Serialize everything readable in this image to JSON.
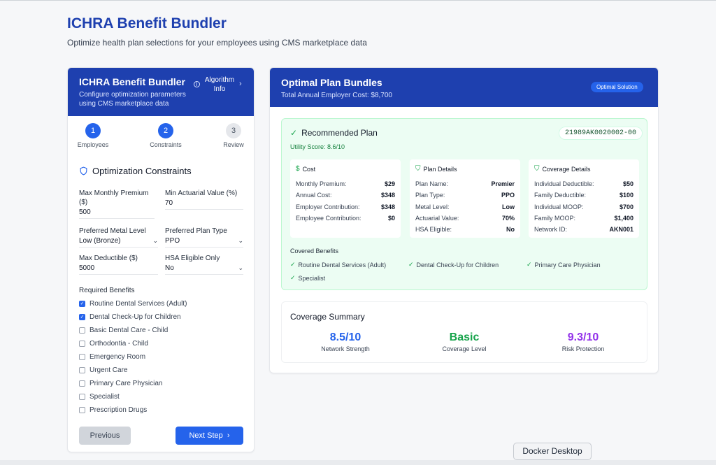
{
  "page": {
    "title": "ICHRA Benefit Bundler",
    "subtitle": "Optimize health plan selections for your employees using CMS marketplace data"
  },
  "left": {
    "header_title": "ICHRA Benefit Bundler",
    "header_desc": "Configure optimization parameters using CMS marketplace data",
    "algo_label": "Algorithm Info",
    "steps": [
      {
        "num": "1",
        "label": "Employees"
      },
      {
        "num": "2",
        "label": "Constraints"
      },
      {
        "num": "3",
        "label": "Review"
      }
    ],
    "section_title": "Optimization Constraints",
    "fields": {
      "max_premium_label": "Max Monthly Premium ($)",
      "max_premium_value": "500",
      "min_av_label": "Min Actuarial Value (%)",
      "min_av_value": "70",
      "metal_label": "Preferred Metal Level",
      "metal_value": "Low (Bronze)",
      "plan_type_label": "Preferred Plan Type",
      "plan_type_value": "PPO",
      "deductible_label": "Max Deductible ($)",
      "deductible_value": "5000",
      "hsa_label": "HSA Eligible Only",
      "hsa_value": "No"
    },
    "required_title": "Required Benefits",
    "benefits": [
      {
        "label": "Routine Dental Services (Adult)",
        "checked": true
      },
      {
        "label": "Dental Check-Up for Children",
        "checked": true
      },
      {
        "label": "Basic Dental Care - Child",
        "checked": false
      },
      {
        "label": "Orthodontia - Child",
        "checked": false
      },
      {
        "label": "Emergency Room",
        "checked": false
      },
      {
        "label": "Urgent Care",
        "checked": false
      },
      {
        "label": "Primary Care Physician",
        "checked": false
      },
      {
        "label": "Specialist",
        "checked": false
      },
      {
        "label": "Prescription Drugs",
        "checked": false
      }
    ],
    "prev_label": "Previous",
    "next_label": "Next Step"
  },
  "right": {
    "header_title": "Optimal Plan Bundles",
    "header_sub": "Total Annual Employer Cost: $8,700",
    "badge": "Optimal Solution",
    "rec_title": "Recommended Plan",
    "plan_id": "21989AK0020002-00",
    "utility": "Utility Score: 8.6/10",
    "cost": {
      "title": "Cost",
      "rows": [
        {
          "k": "Monthly Premium:",
          "v": "$29"
        },
        {
          "k": "Annual Cost:",
          "v": "$348"
        },
        {
          "k": "Employer Contribution:",
          "v": "$348"
        },
        {
          "k": "Employee Contribution:",
          "v": "$0"
        }
      ]
    },
    "plan_details": {
      "title": "Plan Details",
      "rows": [
        {
          "k": "Plan Name:",
          "v": "Premier"
        },
        {
          "k": "Plan Type:",
          "v": "PPO"
        },
        {
          "k": "Metal Level:",
          "v": "Low"
        },
        {
          "k": "Actuarial Value:",
          "v": "70%"
        },
        {
          "k": "HSA Eligible:",
          "v": "No"
        }
      ]
    },
    "coverage_details": {
      "title": "Coverage Details",
      "rows": [
        {
          "k": "Individual Deductible:",
          "v": "$50"
        },
        {
          "k": "Family Deductible:",
          "v": "$100"
        },
        {
          "k": "Individual MOOP:",
          "v": "$700"
        },
        {
          "k": "Family MOOP:",
          "v": "$1,400"
        },
        {
          "k": "Network ID:",
          "v": "AKN001"
        }
      ]
    },
    "covered_title": "Covered Benefits",
    "covered": [
      "Routine Dental Services (Adult)",
      "Dental Check-Up for Children",
      "Primary Care Physician",
      "Specialist"
    ],
    "summary_title": "Coverage Summary",
    "metrics": [
      {
        "value": "8.5/10",
        "label": "Network Strength",
        "color": "#2563eb"
      },
      {
        "value": "Basic",
        "label": "Coverage Level",
        "color": "#16a34a"
      },
      {
        "value": "9.3/10",
        "label": "Risk Protection",
        "color": "#9333ea"
      }
    ]
  },
  "tooltip": "Docker Desktop"
}
